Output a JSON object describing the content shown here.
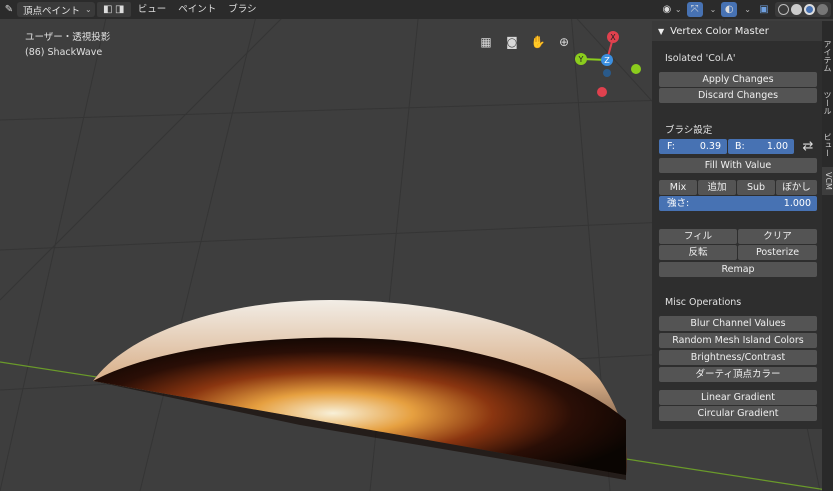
{
  "header": {
    "mode_label": "頂点ペイント",
    "menus": [
      "ビュー",
      "ペイント",
      "ブラシ"
    ]
  },
  "viewport": {
    "view_name": "ユーザー・透視投影",
    "object_name": "(86) ShackWave"
  },
  "gizmo": {
    "x_label": "X",
    "y_label": "Y",
    "z_label": "Z",
    "colors": {
      "x": "#e0414e",
      "y": "#8bcd1d",
      "z": "#3b8fe0"
    }
  },
  "panel": {
    "title": "Vertex Color Master",
    "isolated_label": "Isolated 'Col.A'",
    "apply_changes": "Apply Changes",
    "discard_changes": "Discard Changes",
    "brush_settings_label": "ブラシ設定",
    "f_label": "F:",
    "f_value": "0.39",
    "b_label": "B:",
    "b_value": "1.00",
    "fill_with_value": "Fill With Value",
    "blend_modes": [
      "Mix",
      "追加",
      "Sub",
      "ぼかし"
    ],
    "strength_label": "強さ:",
    "strength_value": "1.000",
    "fill": "フィル",
    "clear": "クリア",
    "invert": "反転",
    "posterize": "Posterize",
    "remap": "Remap",
    "misc_label": "Misc Operations",
    "misc_buttons": [
      "Blur Channel Values",
      "Random Mesh Island Colors",
      "Brightness/Contrast",
      "ダーティ頂点カラー",
      "Linear Gradient",
      "Circular Gradient"
    ]
  },
  "tabs": [
    "アイテム",
    "ツール",
    "ビュー",
    "VCM"
  ],
  "colors": {
    "accent_blue": "#4772b3",
    "button_gray": "#545454",
    "panel_bg": "#2e2e2e"
  }
}
